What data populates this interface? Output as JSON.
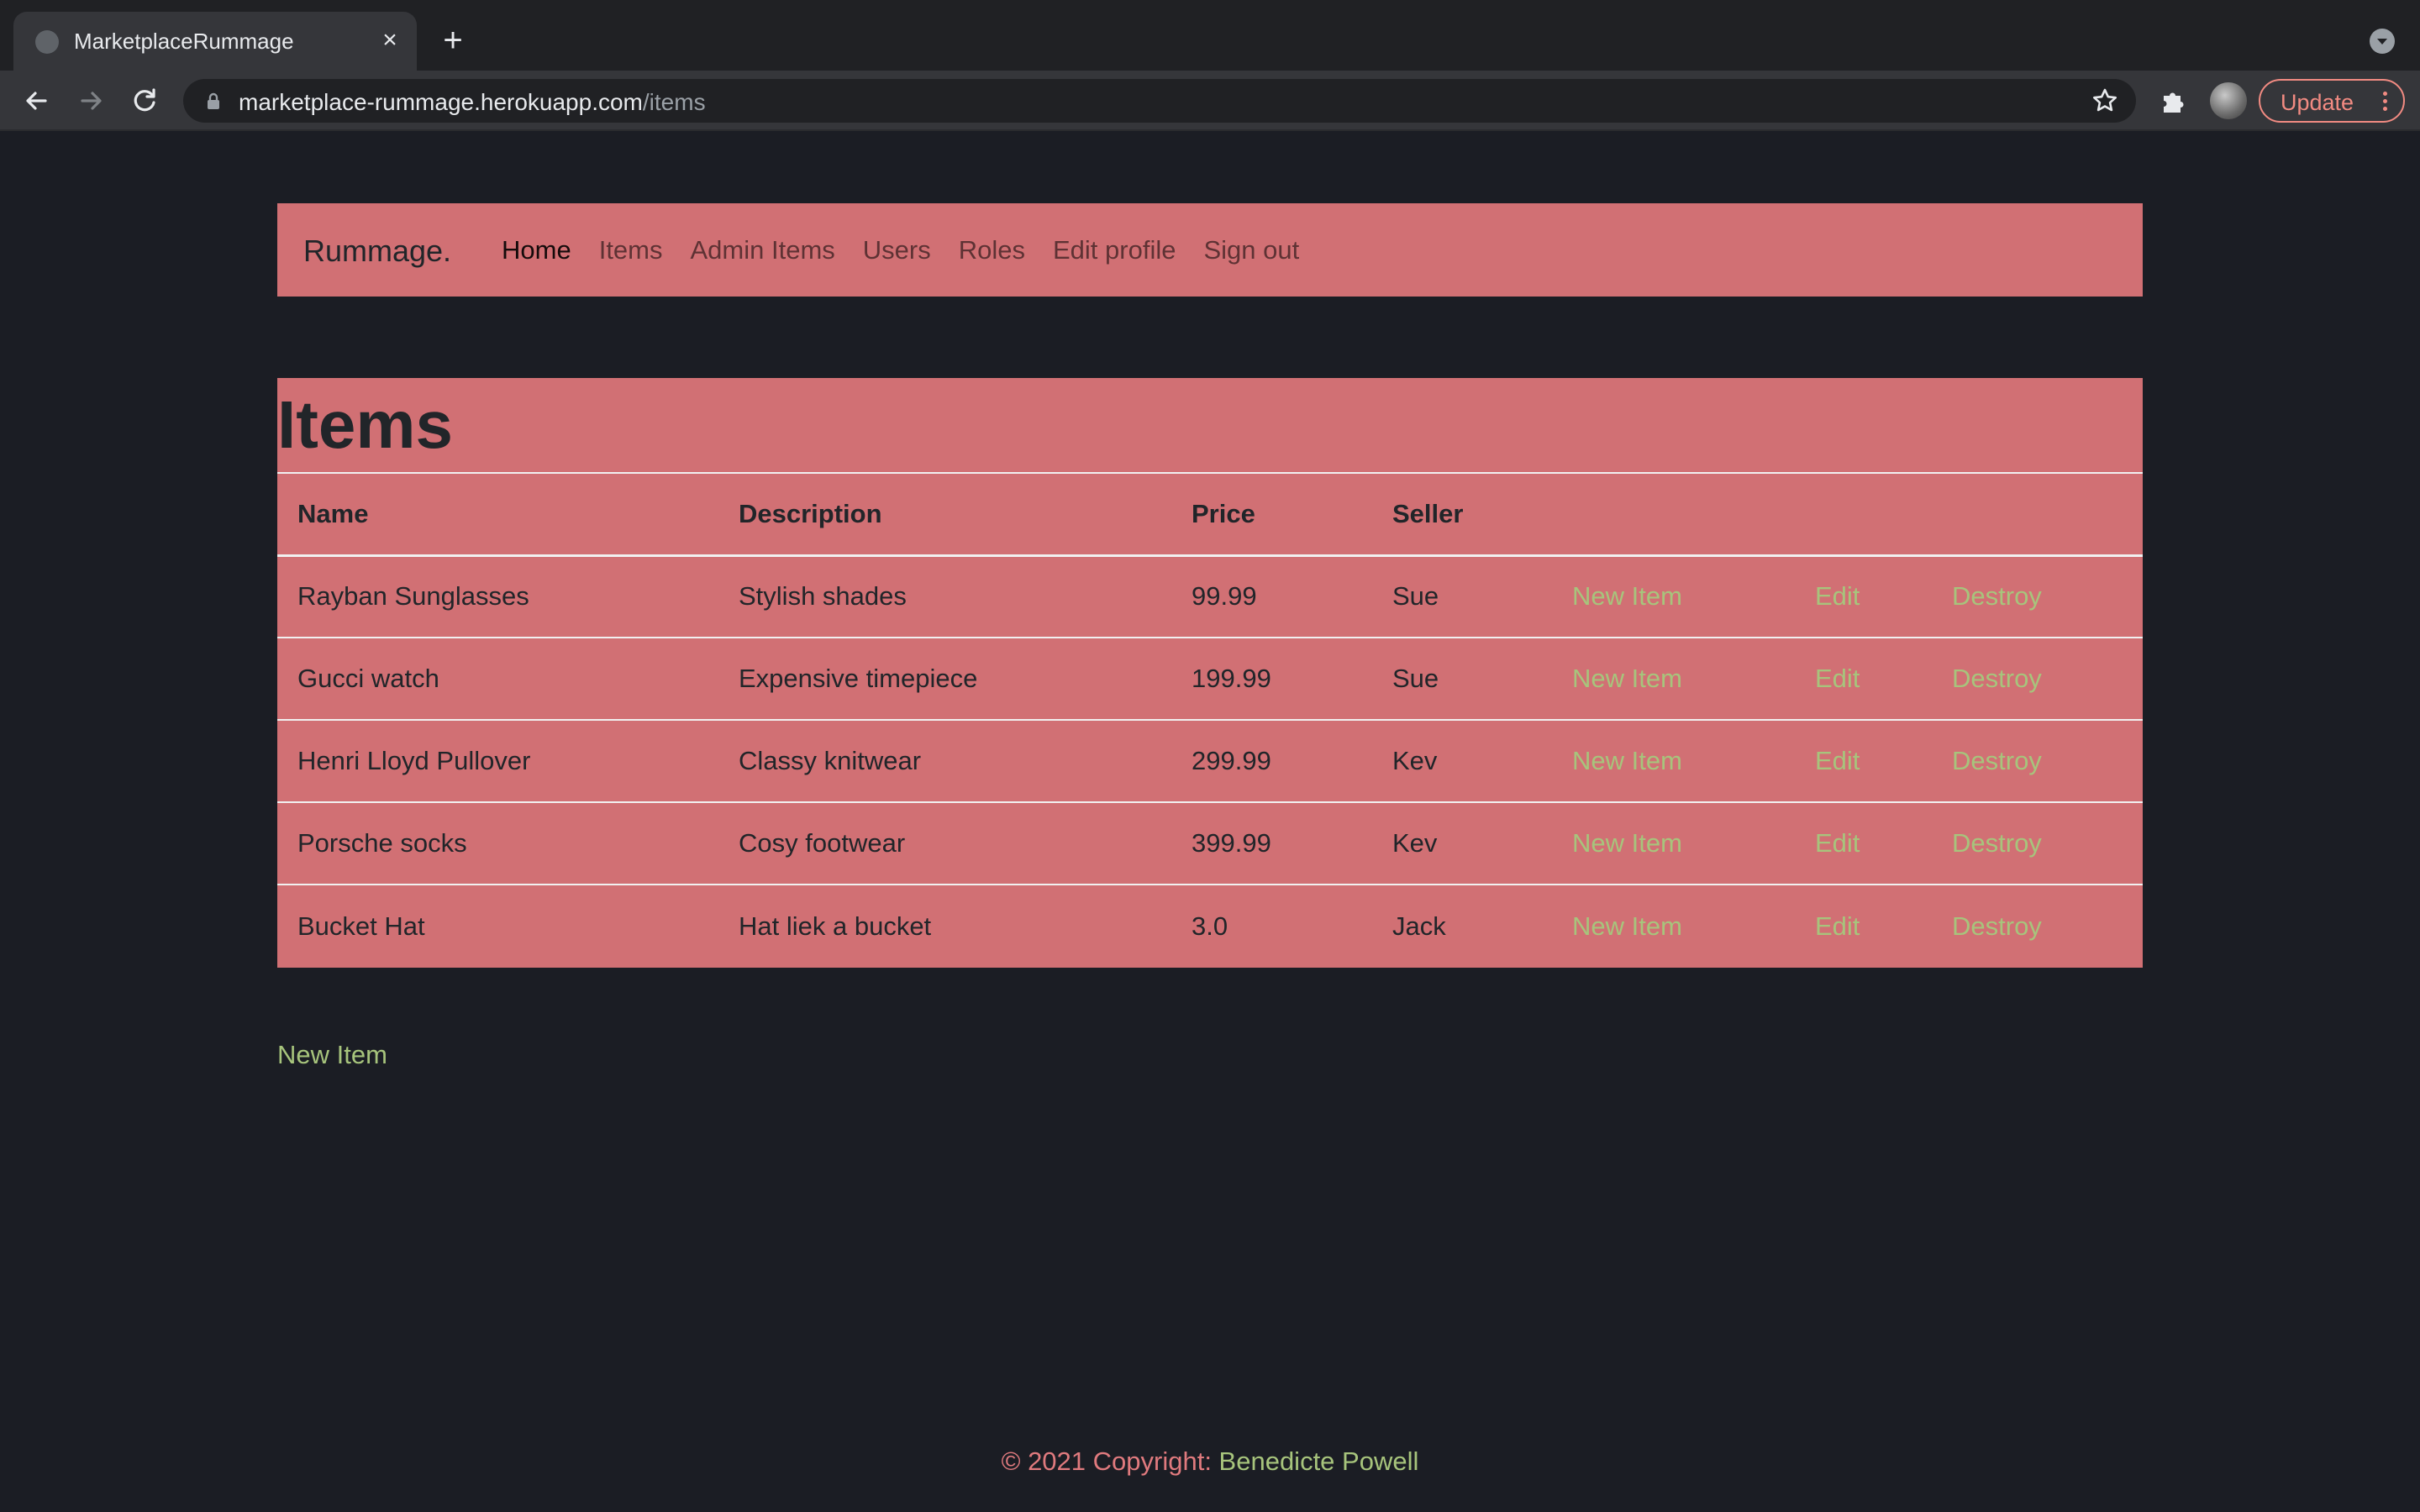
{
  "browser": {
    "tab_title": "MarketplaceRummage",
    "url_host": "marketplace-rummage.herokuapp.com",
    "url_path": "/items",
    "update_label": "Update",
    "icons": [
      "back-arrow-icon",
      "forward-arrow-icon",
      "reload-icon",
      "lock-icon",
      "star-icon",
      "extensions-icon",
      "avatar",
      "close-icon",
      "plus-icon"
    ]
  },
  "navbar": {
    "brand": "Rummage.",
    "links": [
      {
        "label": "Home",
        "active": true
      },
      {
        "label": "Items",
        "active": false
      },
      {
        "label": "Admin Items",
        "active": false
      },
      {
        "label": "Users",
        "active": false
      },
      {
        "label": "Roles",
        "active": false
      },
      {
        "label": "Edit profile",
        "active": false
      },
      {
        "label": "Sign out",
        "active": false
      }
    ]
  },
  "main": {
    "title": "Items",
    "columns": [
      "Name",
      "Description",
      "Price",
      "Seller"
    ],
    "rows": [
      {
        "name": "Rayban Sunglasses",
        "description": "Stylish shades",
        "price": "99.99",
        "seller": "Sue",
        "new": "New Item",
        "edit": "Edit",
        "destroy": "Destroy"
      },
      {
        "name": "Gucci watch",
        "description": "Expensive timepiece",
        "price": "199.99",
        "seller": "Sue",
        "new": "New Item",
        "edit": "Edit",
        "destroy": "Destroy"
      },
      {
        "name": "Henri Lloyd Pullover",
        "description": "Classy knitwear",
        "price": "299.99",
        "seller": "Kev",
        "new": "New Item",
        "edit": "Edit",
        "destroy": "Destroy"
      },
      {
        "name": "Porsche socks",
        "description": "Cosy footwear",
        "price": "399.99",
        "seller": "Kev",
        "new": "New Item",
        "edit": "Edit",
        "destroy": "Destroy"
      },
      {
        "name": "Bucket Hat",
        "description": "Hat liek a bucket",
        "price": "3.0",
        "seller": "Jack",
        "new": "New Item",
        "edit": "Edit",
        "destroy": "Destroy"
      }
    ],
    "new_item_link": "New Item"
  },
  "footer": {
    "text": "© 2021 Copyright: ",
    "author": "Benedicte Powell"
  },
  "colors": {
    "page_bg": "#1b1d24",
    "card_bg": "#d17074",
    "link_green": "#a7c47c",
    "footer_red": "#e07a7e"
  }
}
